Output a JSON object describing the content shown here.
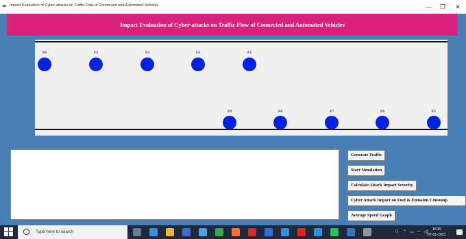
{
  "window": {
    "title": "Impact Evaluation of Cyber-attacks on Traffic Flow of Connected and Automated Vehicles",
    "minimize_glyph": "—",
    "maximize_glyph": "❐",
    "close_glyph": "✕"
  },
  "header": {
    "title": "Impact Evaluation of Cyber-attacks on Traffic Flow of Connected and Automated Vehicles",
    "banner_color": "#d9217e"
  },
  "road": {
    "vehicle_color": "#0522e0",
    "top_lane": [
      {
        "label": "F6"
      },
      {
        "label": "F2"
      },
      {
        "label": "F2"
      },
      {
        "label": "F2"
      },
      {
        "label": "F2"
      }
    ],
    "bottom_lane": [
      {
        "label": "F9"
      },
      {
        "label": "F8"
      },
      {
        "label": "F7"
      },
      {
        "label": "F6"
      },
      {
        "label": "F5"
      }
    ]
  },
  "log": {
    "text": ""
  },
  "actions": {
    "generate_traffic": "Generate Traffic",
    "start_simulation": "Start Simulation",
    "calculate_severity": "Calculate Attack Impact Severity",
    "fuel_emission": "Cyber Attack Impact on Fuel & Emission Consump",
    "average_speed": "Average Speed Graph"
  },
  "taskbar": {
    "search_placeholder": "Type here to search",
    "clock_time": "18:30",
    "clock_date": "07-01-2021",
    "tray_text": "ENG",
    "pinned_icons": [
      "task-view-icon",
      "edge-icon",
      "file-explorer-icon",
      "store-icon",
      "ie-icon",
      "chrome-icon",
      "firefox-icon",
      "opera-icon",
      "mail-icon",
      "photos-icon",
      "acrobat-icon",
      "vscode-icon",
      "pycharm-icon",
      "python-icon",
      "settings-icon"
    ]
  }
}
